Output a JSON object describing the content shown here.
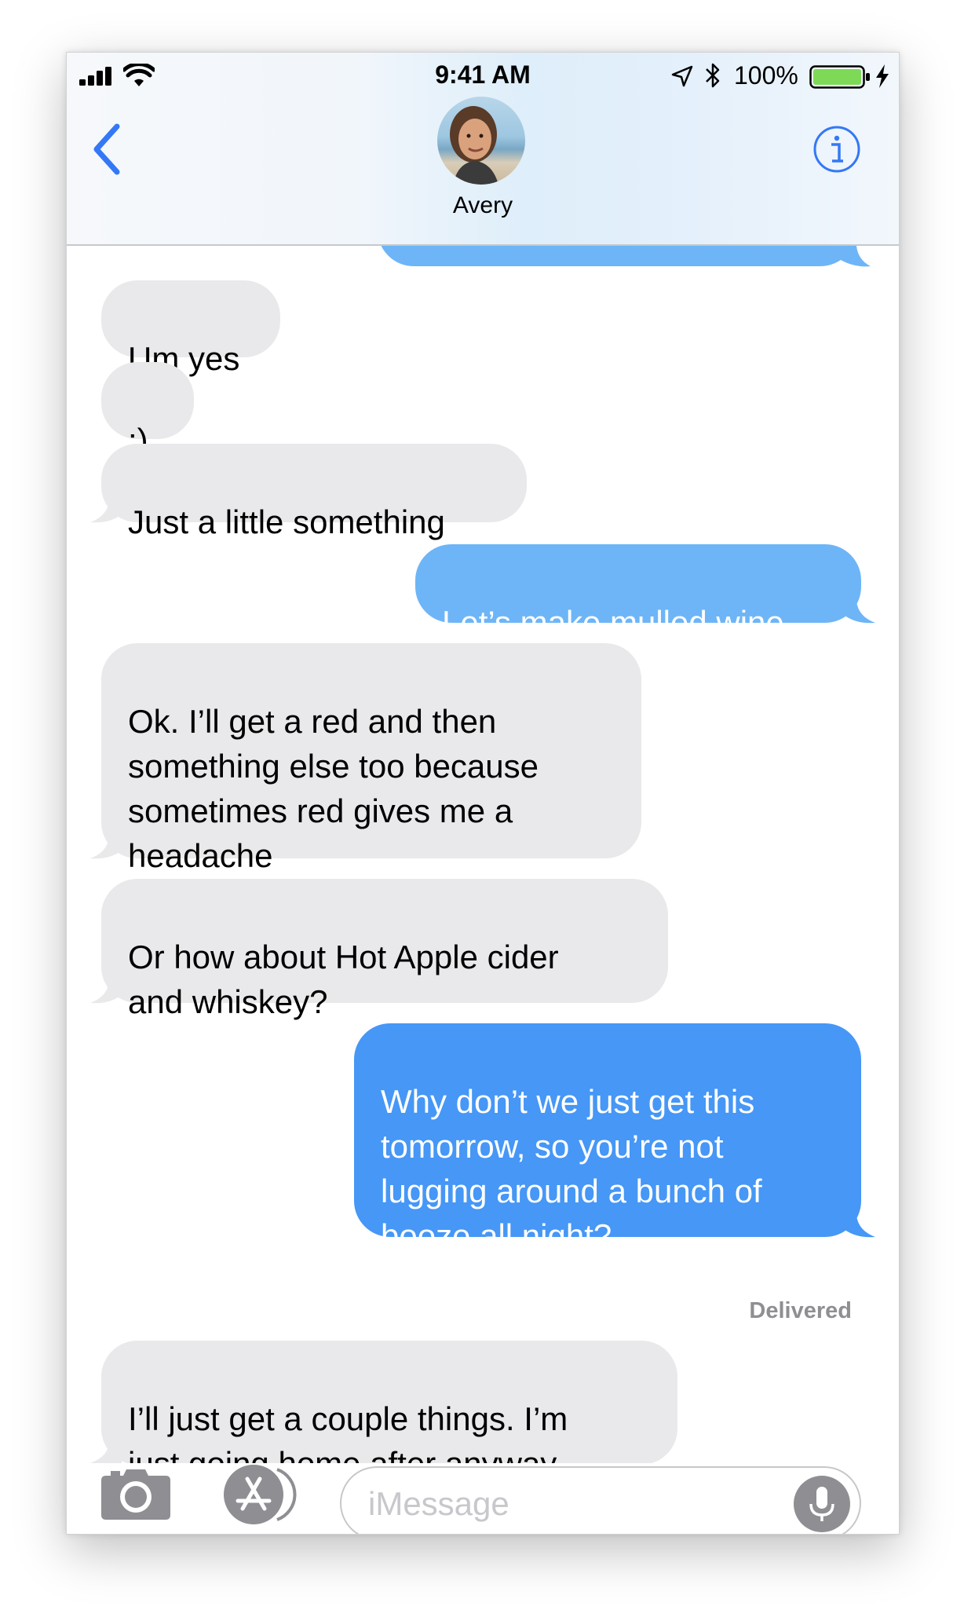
{
  "status_bar": {
    "time": "9:41 AM",
    "battery_percent": "100%",
    "icons": [
      "signal-icon",
      "wifi-icon",
      "location-icon",
      "bluetooth-icon",
      "battery-icon",
      "charging-icon"
    ]
  },
  "header": {
    "contact_name": "Avery",
    "back_icon": "chevron-left-icon",
    "info_icon": "info-icon"
  },
  "messages": [
    {
      "direction": "received",
      "text": "Um yes"
    },
    {
      "direction": "received",
      "text": ":)"
    },
    {
      "direction": "received",
      "text": "Just a little something"
    },
    {
      "direction": "sent",
      "text": "Let’s make mulled wine"
    },
    {
      "direction": "received",
      "text": "Ok. I’ll get a red and then\nsomething else too because\nsometimes red gives me a\nheadache"
    },
    {
      "direction": "received",
      "text": "Or how about Hot Apple cider\nand whiskey?"
    },
    {
      "direction": "sent",
      "text": "Why don’t we just get this\ntomorrow, so you’re not\nlugging around a bunch of\nbooze all night?"
    },
    {
      "direction": "received",
      "text": "I’ll just get a couple things. I’m\njust going home after anyway"
    }
  ],
  "delivered_label": "Delivered",
  "input_bar": {
    "placeholder": "iMessage",
    "icons": [
      "camera-icon",
      "app-store-icon",
      "microphone-icon"
    ]
  },
  "colors": {
    "received_bubble": "#e9e9eb",
    "sent_bubble_light": "#6db5f7",
    "sent_bubble": "#4697f6",
    "accent": "#3478f6",
    "battery_fill": "#7ed957"
  }
}
